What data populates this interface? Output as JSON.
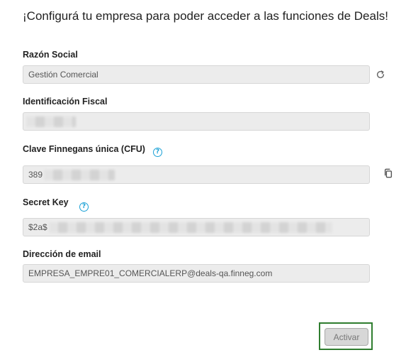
{
  "heading": "¡Configurá tu empresa para poder acceder a las funciones de Deals!",
  "fields": {
    "razon_social": {
      "label": "Razón Social",
      "value": "Gestión Comercial"
    },
    "identificacion_fiscal": {
      "label": "Identificación Fiscal",
      "value": ""
    },
    "clave_cfu": {
      "label": "Clave Finnegans única (CFU)",
      "value": "389"
    },
    "secret_key": {
      "label": "Secret Key",
      "value": "$2a$"
    },
    "email": {
      "label": "Dirección de email",
      "value": "EMPRESA_EMPRE01_COMERCIALERP@deals-qa.finneg.com"
    }
  },
  "help_icon_glyph": "?",
  "activate_button_label": "Activar",
  "icons": {
    "refresh": "refresh-icon",
    "copy": "copy-icon",
    "help": "help-circle-icon"
  },
  "colors": {
    "help_icon": "#1ba1d6",
    "button_focus_border": "#2f7d2f",
    "field_background": "#ececec"
  }
}
